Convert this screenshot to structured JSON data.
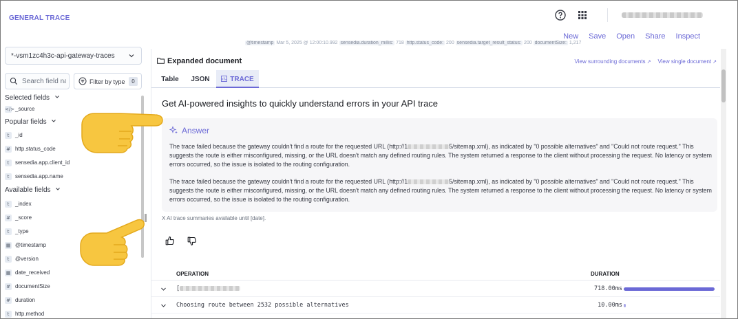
{
  "app": {
    "title": "GENERAL TRACE"
  },
  "header": {
    "actions": [
      "New",
      "Save",
      "Open",
      "Share",
      "Inspect"
    ]
  },
  "sidebar": {
    "index_pattern": "*-vsm1zc4h3c-api-gateway-traces",
    "search_placeholder": "Search field names",
    "filter_label": "Filter by type",
    "filter_count": "0",
    "selected_heading": "Selected fields",
    "selected_fields": [
      {
        "token": "</>",
        "name": "_source"
      }
    ],
    "popular_heading": "Popular fields",
    "popular_fields": [
      {
        "token": "t",
        "name": "_id"
      },
      {
        "token": "#",
        "name": "http.status_code"
      },
      {
        "token": "t",
        "name": "sensedia.app.client_id"
      },
      {
        "token": "t",
        "name": "sensedia.app.name"
      }
    ],
    "available_heading": "Available fields",
    "available_fields": [
      {
        "token": "t",
        "name": "_index"
      },
      {
        "token": "#",
        "name": "_score"
      },
      {
        "token": "t",
        "name": "_type"
      },
      {
        "token": "▦",
        "name": "@timestamp"
      },
      {
        "token": "t",
        "name": "@version"
      },
      {
        "token": "▦",
        "name": "date_received"
      },
      {
        "token": "#",
        "name": "documentSize"
      },
      {
        "token": "#",
        "name": "duration"
      },
      {
        "token": "t",
        "name": "http.method"
      }
    ]
  },
  "peek": {
    "line": [
      {
        "k": "@timestamp",
        "v": " Mar 5, 2025 @ 12:00:10.992 "
      },
      {
        "k": "sensedia.duration_millis:",
        "v": " 718 "
      },
      {
        "k": "http.status_code:",
        "v": " 200 "
      },
      {
        "k": "sensedia.target_result_status:",
        "v": " 200 "
      },
      {
        "k": "documentSize:",
        "v": " 1,217"
      }
    ]
  },
  "flyout": {
    "title": "Expanded document",
    "link_surrounding": "View surrounding documents",
    "link_single": "View single document",
    "tabs": [
      "Table",
      "JSON",
      "TRACE"
    ],
    "insights_heading": "Get AI-powered insights to quickly understand errors in your API trace",
    "answer_heading": "Answer",
    "answer_p1_a": "The trace failed because the gateway couldn't find a route for the requested URL (http://1",
    "answer_p1_b": "5/sitemap.xml), as indicated by \"0 possible alternatives\" and \"Could not route request.\" This suggests the route is either misconfigured, missing, or the URL doesn't match any defined routing rules. The system returned a response to the client without processing the request. No latency or system errors occurred, so the issue is isolated to the routing configuration.",
    "answer_p2_a": "The trace failed because the gateway couldn't find a route for the requested URL (http://1",
    "answer_p2_b": "5/sitemap.xml), as indicated by \"0 possible alternatives\" and \"Could not route request.\" This suggests the route is either misconfigured, missing, or the URL doesn't match any defined routing rules. The system returned a response to the client without processing the request. No latency or system errors occurred, so the issue is isolated to the routing configuration.",
    "availability_note": "X AI trace summaries available until [date]."
  },
  "operations": {
    "col_operation": "OPERATION",
    "col_duration": "DURATION",
    "rows": [
      {
        "name_prefix": "[",
        "name": "",
        "duration": "718.00ms",
        "ratio": 1.0
      },
      {
        "name_prefix": "",
        "name": "Choosing route between 2532 possible alternatives",
        "duration": "10.00ms",
        "ratio": 0.014
      }
    ]
  },
  "colors": {
    "accent": "#6b69d6",
    "text": "#343741",
    "muted": "#69707d"
  }
}
